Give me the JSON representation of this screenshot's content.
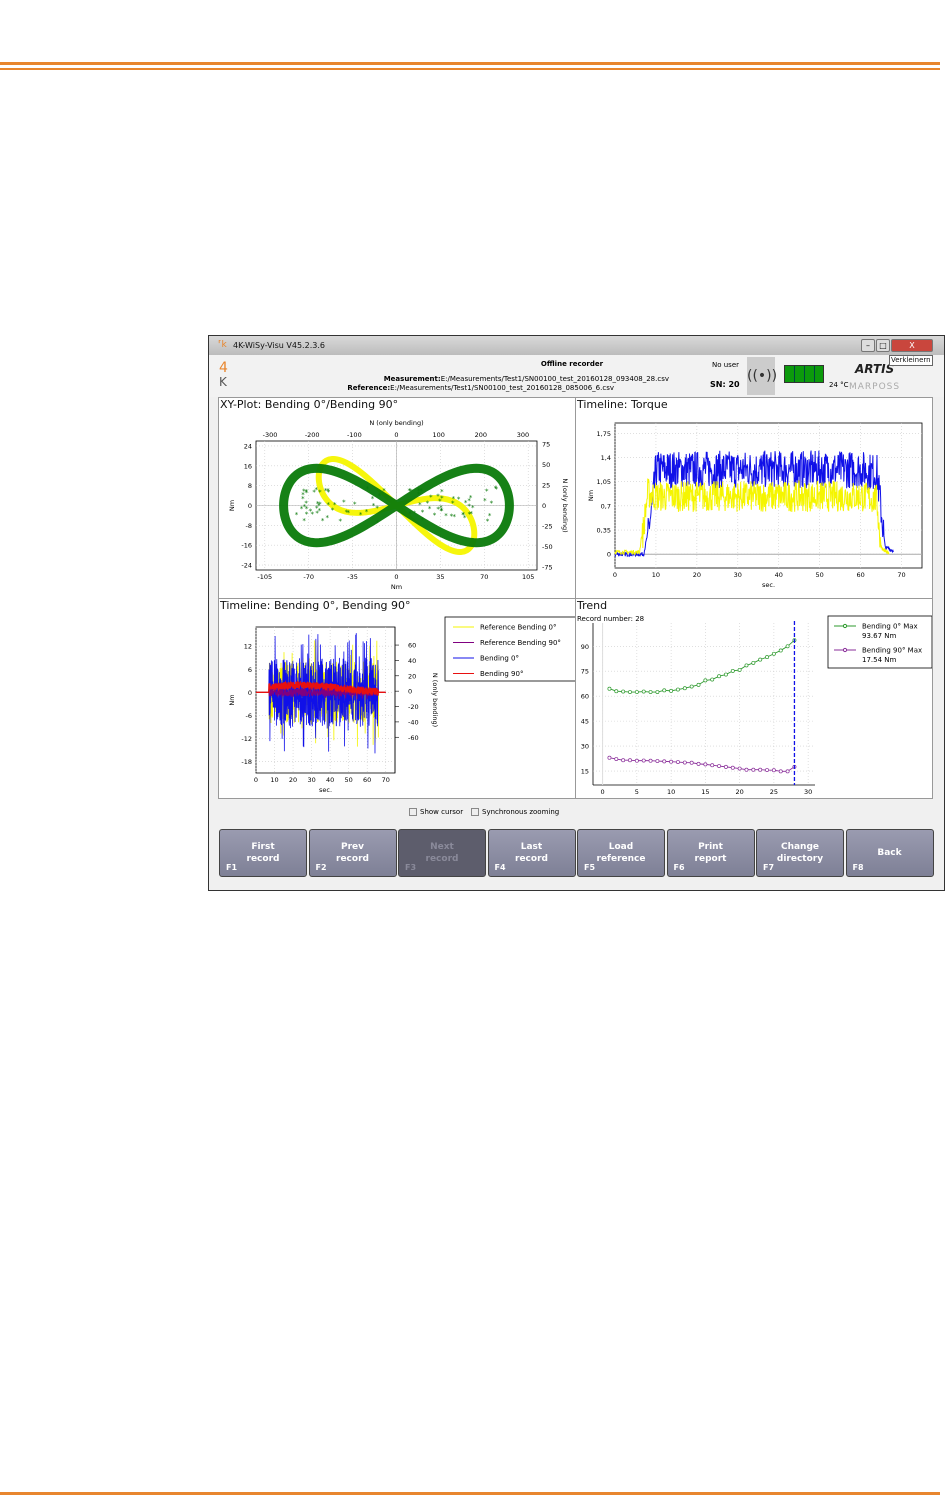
{
  "colors": {
    "rule": "#e8862e",
    "blue": "#1010e8",
    "yellow": "#f5f500",
    "green": "#0a7a0a",
    "trend_green": "#2e9a2e",
    "trend_purple": "#8a2e9a",
    "red": "#e81010",
    "purple": "#800080"
  },
  "window": {
    "title": "4K-WiSy-Visu   V45.2.3.6",
    "tooltip": "Verkleinern",
    "minimize": "–",
    "maximize": "□",
    "close": "X"
  },
  "header": {
    "title": "Offline recorder",
    "measurement_label": "Measurement:",
    "measurement_path": "E:/Measurements/Test1/SN00100_test_20160128_093408_28.csv",
    "reference_label": "Reference:",
    "reference_path": "E:/Measurements/Test1/SN00100_test_20160128_085006_6.csv",
    "user": "No user",
    "sn": "SN: 20",
    "temperature": "24 °C",
    "logo_4k": "4K",
    "brand1": "ARTIS",
    "brand2": "MARPOSS",
    "battery_level": 1.0
  },
  "options": {
    "show_cursor": "Show cursor",
    "sync_zoom": "Synchronous zooming"
  },
  "buttons": [
    {
      "label1": "First",
      "label2": "record",
      "key": "F1",
      "enabled": true
    },
    {
      "label1": "Prev",
      "label2": "record",
      "key": "F2",
      "enabled": true
    },
    {
      "label1": "Next",
      "label2": "record",
      "key": "F3",
      "enabled": false
    },
    {
      "label1": "Last",
      "label2": "record",
      "key": "F4",
      "enabled": true
    },
    {
      "label1": "Load",
      "label2": "reference",
      "key": "F5",
      "enabled": true
    },
    {
      "label1": "Print",
      "label2": "report",
      "key": "F6",
      "enabled": true
    },
    {
      "label1": "Change",
      "label2": "directory",
      "key": "F7",
      "enabled": true
    },
    {
      "label1": "Back",
      "label2": "",
      "key": "F8",
      "enabled": true
    }
  ],
  "chart_data": [
    {
      "id": "xy",
      "type": "scatter",
      "title": "XY-Plot:  Bending 0°/Bending 90°",
      "xlabel": "Nm",
      "ylabel": "Nm",
      "x2label": "N (only bending)",
      "y2label": "N (only bending)",
      "xlim": [
        -112,
        112
      ],
      "ylim": [
        -26,
        26
      ],
      "xticks": [
        "-105",
        "-70",
        "-35",
        "0",
        "35",
        "70",
        "105"
      ],
      "yticks": [
        "24",
        "16",
        "8",
        "0",
        "-8",
        "-16",
        "-24"
      ],
      "x2ticks": [
        "-300",
        "-200",
        "-100",
        "0",
        "100",
        "200",
        "300"
      ],
      "y2ticks": [
        "75",
        "50",
        "25",
        "0",
        "-25",
        "-50",
        "-75"
      ],
      "series": [
        {
          "color": "#f5f500",
          "shape": "figure-eight",
          "x_extent": [
            -65,
            62
          ],
          "y_extent": [
            -20,
            20
          ]
        },
        {
          "color": "#0a7a0a",
          "shape": "figure-eight",
          "x_extent": [
            -88,
            92
          ],
          "y_extent": [
            -16,
            17
          ]
        }
      ]
    },
    {
      "id": "torque",
      "type": "line",
      "title": "Timeline:  Torque",
      "xlabel": "sec.",
      "ylabel": "Nm",
      "xlim": [
        0,
        75
      ],
      "ylim": [
        -0.2,
        1.9
      ],
      "xticks": [
        "0",
        "10",
        "20",
        "30",
        "40",
        "50",
        "60",
        "70"
      ],
      "yticks": [
        "1,75",
        "1,4",
        "1,05",
        "0,7",
        "0,35",
        "0"
      ],
      "series": [
        {
          "color": "#1010e8",
          "x": [
            0,
            7,
            9,
            10,
            20,
            30,
            40,
            50,
            60,
            64,
            66,
            68
          ],
          "y": [
            0,
            0,
            0.6,
            1.2,
            1.2,
            1.2,
            1.2,
            1.2,
            1.2,
            1.15,
            0.1,
            0.05
          ]
        },
        {
          "color": "#f5f500",
          "x": [
            0,
            6,
            8,
            10,
            20,
            30,
            40,
            50,
            60,
            64,
            65,
            67
          ],
          "y": [
            0.03,
            0.03,
            1.0,
            0.95,
            0.95,
            0.95,
            0.95,
            0.95,
            0.95,
            0.9,
            0.1,
            0
          ]
        }
      ]
    },
    {
      "id": "bending",
      "type": "line",
      "title": "Timeline:  Bending 0°, Bending 90°",
      "xlabel": "sec.",
      "ylabel": "Nm",
      "y2label": "N (only bending)",
      "xlim": [
        0,
        75
      ],
      "ylim": [
        -21,
        17
      ],
      "xticks": [
        "0",
        "10",
        "20",
        "30",
        "40",
        "50",
        "60",
        "70"
      ],
      "yticks": [
        "12",
        "6",
        "0",
        "-6",
        "-12",
        "-18"
      ],
      "y2ticks": [
        "60",
        "40",
        "20",
        "0",
        "-20",
        "-40",
        "-60"
      ],
      "legend": "top-right",
      "series": [
        {
          "name": "Reference Bending 0°",
          "color": "#f5f500",
          "amplitude": 8
        },
        {
          "name": "Reference Bending 90°",
          "color": "#800080",
          "amplitude": 1
        },
        {
          "name": "Bending 0°",
          "color": "#1010e8",
          "amplitude": 9,
          "extent": [
            7,
            66
          ]
        },
        {
          "name": "Bending 90°",
          "color": "#e81010",
          "amplitude": 1.5,
          "extent": [
            7,
            66
          ]
        }
      ]
    },
    {
      "id": "trend",
      "type": "line",
      "title": "Trend",
      "subtitle": "Record number: 28",
      "xlim": [
        -1.4,
        31
      ],
      "ylim": [
        6.6,
        104
      ],
      "xticks": [
        "0",
        "5",
        "10",
        "15",
        "20",
        "25",
        "30"
      ],
      "yticks": [
        "90",
        "75",
        "60",
        "45",
        "30",
        "15"
      ],
      "cursor_x": 28,
      "legend": "top-right",
      "x": [
        1,
        2,
        3,
        4,
        5,
        6,
        7,
        8,
        9,
        10,
        11,
        12,
        13,
        14,
        15,
        16,
        17,
        18,
        19,
        20,
        21,
        22,
        23,
        24,
        25,
        26,
        27,
        28
      ],
      "series": [
        {
          "name": "Bending 0° Max",
          "value_label": "93.67 Nm",
          "color": "#2e9a2e",
          "values": [
            64.5,
            63,
            62.8,
            62.5,
            62.5,
            62.8,
            62.5,
            62.5,
            63.5,
            63.2,
            64,
            64.8,
            65.8,
            66.8,
            69.5,
            70,
            72,
            73,
            75.2,
            75.8,
            78.5,
            80,
            82,
            83.5,
            85.5,
            87.5,
            90,
            93.67
          ]
        },
        {
          "name": "Bending 90° Max",
          "value_label": "17.54 Nm",
          "color": "#8a2e9a",
          "values": [
            23,
            22.2,
            21.5,
            21.5,
            21.2,
            21.3,
            21.2,
            21,
            20.8,
            20.6,
            20.4,
            20.1,
            20,
            19.3,
            19,
            18.5,
            18,
            17.5,
            17,
            16.5,
            15.8,
            15.8,
            15.8,
            15.6,
            15.5,
            14.8,
            14.8,
            17.54
          ]
        }
      ]
    }
  ]
}
